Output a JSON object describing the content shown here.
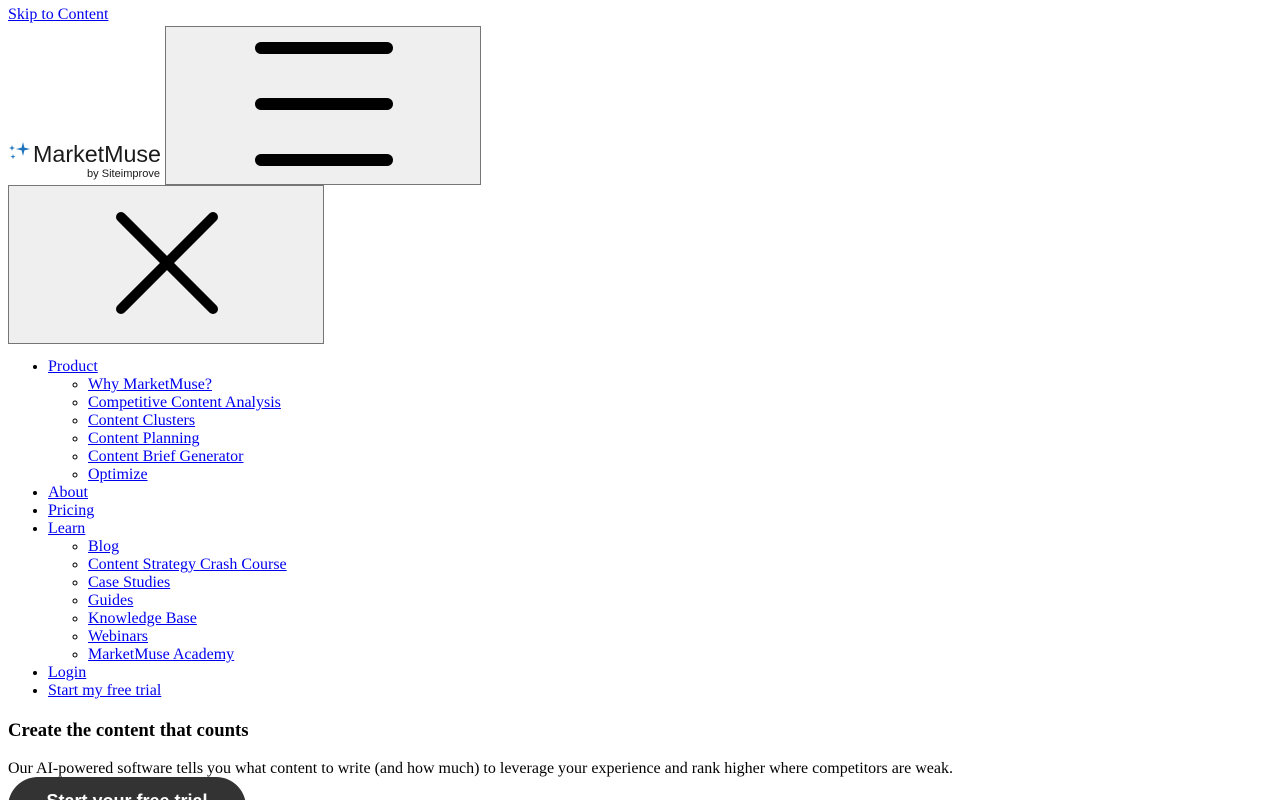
{
  "skip_link": "Skip to Content",
  "logo": {
    "name": "MarketMuse",
    "byline": "by Siteimprove",
    "sparkle_color": "#1e73be",
    "text_color": "#1a1a1a"
  },
  "menu_toggle": {
    "icon": "hamburger-menu-icon"
  },
  "menu_close": {
    "icon": "close-icon"
  },
  "nav": {
    "product": {
      "label": "Product",
      "items": [
        "Why MarketMuse?",
        "Competitive Content Analysis",
        "Content Clusters",
        "Content Planning",
        "Content Brief Generator",
        "Optimize"
      ]
    },
    "about": "About",
    "pricing": "Pricing",
    "learn": {
      "label": "Learn",
      "items": [
        "Blog",
        "Content Strategy Crash Course",
        "Case Studies",
        "Guides",
        "Knowledge Base",
        "Webinars",
        "MarketMuse Academy"
      ]
    },
    "login": "Login",
    "free_trial": "Start my free trial"
  },
  "hero": {
    "title": "Create the content that counts",
    "text": "Our AI-powered software tells you what content to write (and how much) to leverage your experience and rank higher where competitors are weak.",
    "cta": "Start your free trial"
  },
  "colors": {
    "link": "#0000ee",
    "button_bg": "#efefef",
    "button_border": "#767676",
    "cta_bg": "#333333"
  }
}
